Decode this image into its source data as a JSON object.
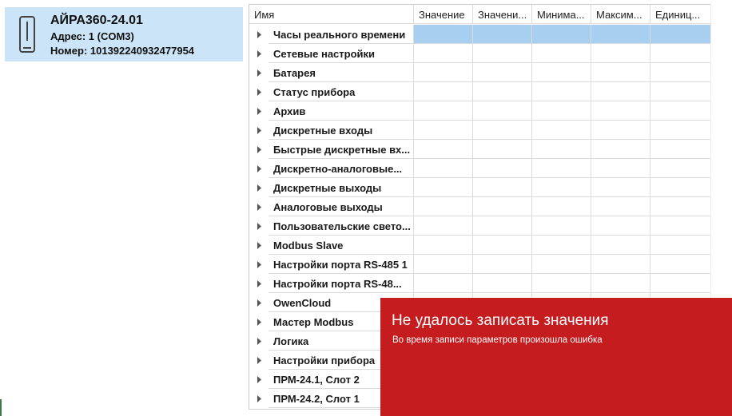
{
  "device": {
    "icon": "device-icon",
    "name": "АЙРА360-24.01",
    "address": "Адрес: 1 (COM3)",
    "serial": "Номер: 101392240932477954"
  },
  "grid": {
    "columns": [
      "Имя",
      "Значение",
      "Значени...",
      "Минима...",
      "Максим...",
      "Единиц..."
    ],
    "rows": [
      {
        "name": "Часы реального времени",
        "selected": true
      },
      {
        "name": "Сетевые настройки"
      },
      {
        "name": "Батарея"
      },
      {
        "name": "Статус прибора"
      },
      {
        "name": "Архив"
      },
      {
        "name": "Дискретные входы"
      },
      {
        "name": "Быстрые дискретные вх..."
      },
      {
        "name": "Дискретно-аналоговые..."
      },
      {
        "name": "Дискретные выходы"
      },
      {
        "name": "Аналоговые выходы"
      },
      {
        "name": "Пользовательские свето..."
      },
      {
        "name": "Modbus Slave"
      },
      {
        "name": "Настройки порта RS-485 1"
      },
      {
        "name": "Настройки порта RS-48..."
      },
      {
        "name": "OwenCloud"
      },
      {
        "name": "Мастер Modbus"
      },
      {
        "name": "Логика"
      },
      {
        "name": "Настройки прибора"
      },
      {
        "name": "ПРМ-24.1, Слот 2"
      },
      {
        "name": "ПРМ-24.2, Слот 1"
      }
    ]
  },
  "toast": {
    "title": "Не удалось записать значения",
    "message": "Во время записи параметров произошла ошибка"
  },
  "colors": {
    "selection": "#cce4f7",
    "row_selected": "#a9cff0",
    "toast_background": "#c51c1f"
  }
}
